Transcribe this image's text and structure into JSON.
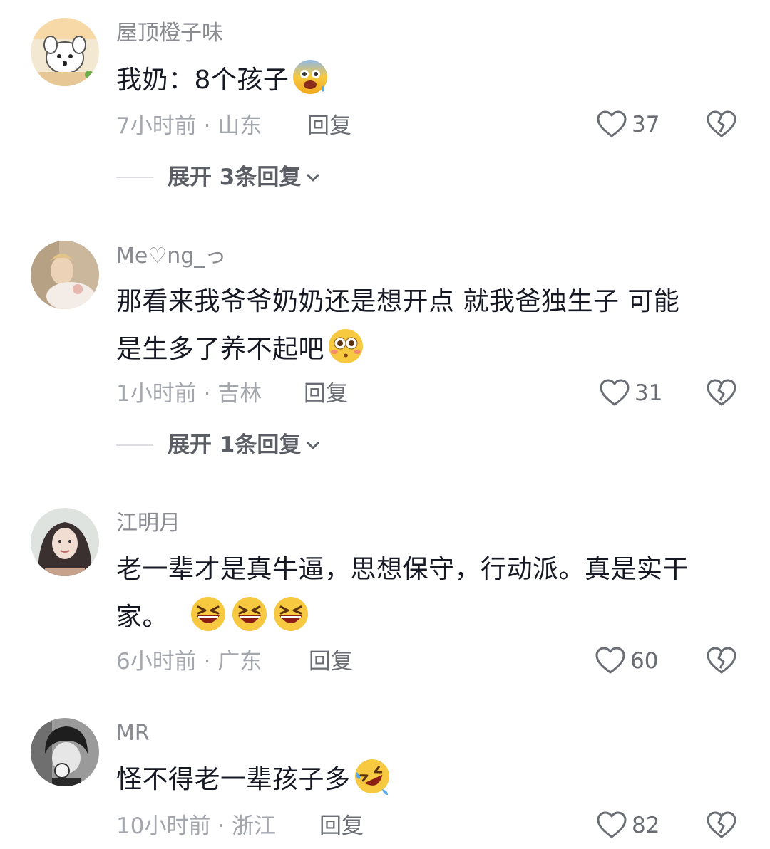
{
  "comments": [
    {
      "username": "屋顶橙子味",
      "text": "我奶：8个孩子",
      "emoji_icon": "fearful-face-emoji",
      "meta": "7小时前 · 山东",
      "reply_label": "回复",
      "likes": "37",
      "expand_label": "展开 3条回复"
    },
    {
      "username": "Me♡ng_っ",
      "text_line1": "那看来我爷爷奶奶还是想开点  就我爸独生子  可能",
      "text_line2": "是生多了养不起吧",
      "emoji_icon": "flushed-face-emoji",
      "meta": "1小时前 · 吉林",
      "reply_label": "回复",
      "likes": "31",
      "expand_label": "展开 1条回复"
    },
    {
      "username": "江明月",
      "text_line1": "老一辈才是真牛逼，思想保守，行动派。真是实干",
      "text_line2": "家。",
      "emoji_icon": "grinning-squinting-face-emoji",
      "meta": "6小时前 · 广东",
      "reply_label": "回复",
      "likes": "60"
    },
    {
      "username": "MR",
      "text": "怪不得老一辈孩子多",
      "emoji_icon": "rolling-on-floor-laughing-emoji",
      "meta": "10小时前 · 浙江",
      "reply_label": "回复",
      "likes": "82"
    }
  ],
  "colors": {
    "text_primary": "#161823",
    "text_secondary": "#8a8b91",
    "meta": "#a4a6ad",
    "icon": "#6b6d74"
  }
}
